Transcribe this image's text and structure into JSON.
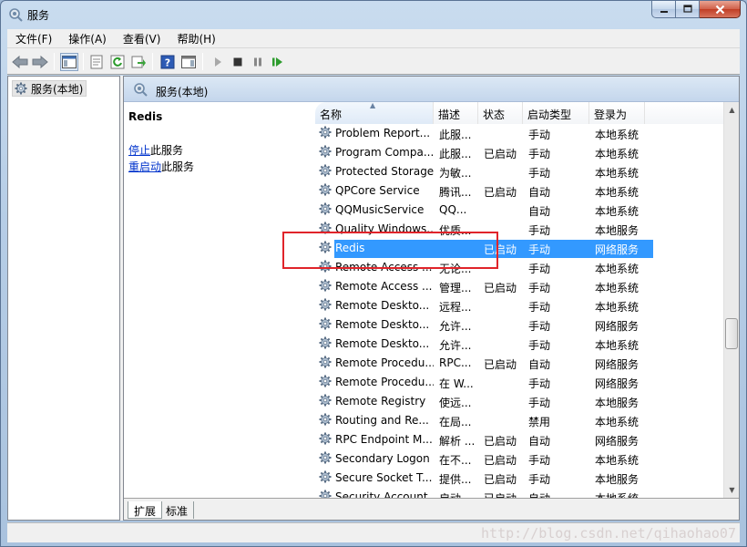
{
  "window": {
    "title": "服务"
  },
  "menu": [
    "文件(F)",
    "操作(A)",
    "查看(V)",
    "帮助(H)"
  ],
  "tree": {
    "root_label": "服务(本地)"
  },
  "panel": {
    "title": "服务(本地)",
    "selected_service": "Redis",
    "actions": [
      {
        "link": "停止",
        "suffix": "此服务"
      },
      {
        "link": "重启动",
        "suffix": "此服务"
      }
    ]
  },
  "columns": {
    "name": "名称",
    "desc": "描述",
    "status": "状态",
    "startup": "启动类型",
    "logon": "登录为"
  },
  "rows": [
    {
      "name": "Problem Report...",
      "desc": "此服...",
      "status": "",
      "startup": "手动",
      "logon": "本地系统"
    },
    {
      "name": "Program Compa...",
      "desc": "此服...",
      "status": "已启动",
      "startup": "手动",
      "logon": "本地系统"
    },
    {
      "name": "Protected Storage",
      "desc": "为敏...",
      "status": "",
      "startup": "手动",
      "logon": "本地系统"
    },
    {
      "name": "QPCore Service",
      "desc": "腾讯...",
      "status": "已启动",
      "startup": "自动",
      "logon": "本地系统"
    },
    {
      "name": "QQMusicService",
      "desc": "QQ...",
      "status": "",
      "startup": "自动",
      "logon": "本地系统"
    },
    {
      "name": "Quality Windows...",
      "desc": "优质...",
      "status": "",
      "startup": "手动",
      "logon": "本地服务"
    },
    {
      "name": "Redis",
      "desc": "",
      "status": "已启动",
      "startup": "手动",
      "logon": "网络服务"
    },
    {
      "name": "Remote Access ...",
      "desc": "无论...",
      "status": "",
      "startup": "手动",
      "logon": "本地系统"
    },
    {
      "name": "Remote Access ...",
      "desc": "管理...",
      "status": "已启动",
      "startup": "手动",
      "logon": "本地系统"
    },
    {
      "name": "Remote Deskto...",
      "desc": "远程...",
      "status": "",
      "startup": "手动",
      "logon": "本地系统"
    },
    {
      "name": "Remote Deskto...",
      "desc": "允许...",
      "status": "",
      "startup": "手动",
      "logon": "网络服务"
    },
    {
      "name": "Remote Deskto...",
      "desc": "允许...",
      "status": "",
      "startup": "手动",
      "logon": "本地系统"
    },
    {
      "name": "Remote Procedu...",
      "desc": "RPC...",
      "status": "已启动",
      "startup": "自动",
      "logon": "网络服务"
    },
    {
      "name": "Remote Procedu...",
      "desc": "在 W...",
      "status": "",
      "startup": "手动",
      "logon": "网络服务"
    },
    {
      "name": "Remote Registry",
      "desc": "使远...",
      "status": "",
      "startup": "手动",
      "logon": "本地服务"
    },
    {
      "name": "Routing and Re...",
      "desc": "在局...",
      "status": "",
      "startup": "禁用",
      "logon": "本地系统"
    },
    {
      "name": "RPC Endpoint M...",
      "desc": "解析 ...",
      "status": "已启动",
      "startup": "自动",
      "logon": "网络服务"
    },
    {
      "name": "Secondary Logon",
      "desc": "在不...",
      "status": "已启动",
      "startup": "手动",
      "logon": "本地系统"
    },
    {
      "name": "Secure Socket T...",
      "desc": "提供...",
      "status": "已启动",
      "startup": "手动",
      "logon": "本地服务"
    },
    {
      "name": "Security Account...",
      "desc": "启动...",
      "status": "已启动",
      "startup": "自动",
      "logon": "本地系统"
    }
  ],
  "selected_row": 6,
  "tabs": [
    "扩展",
    "标准"
  ],
  "watermark": "http://blog.csdn.net/qihaohao07",
  "colors": {
    "selection": "#3399ff",
    "link": "#0033cc",
    "highlight_box": "#e0242a"
  }
}
